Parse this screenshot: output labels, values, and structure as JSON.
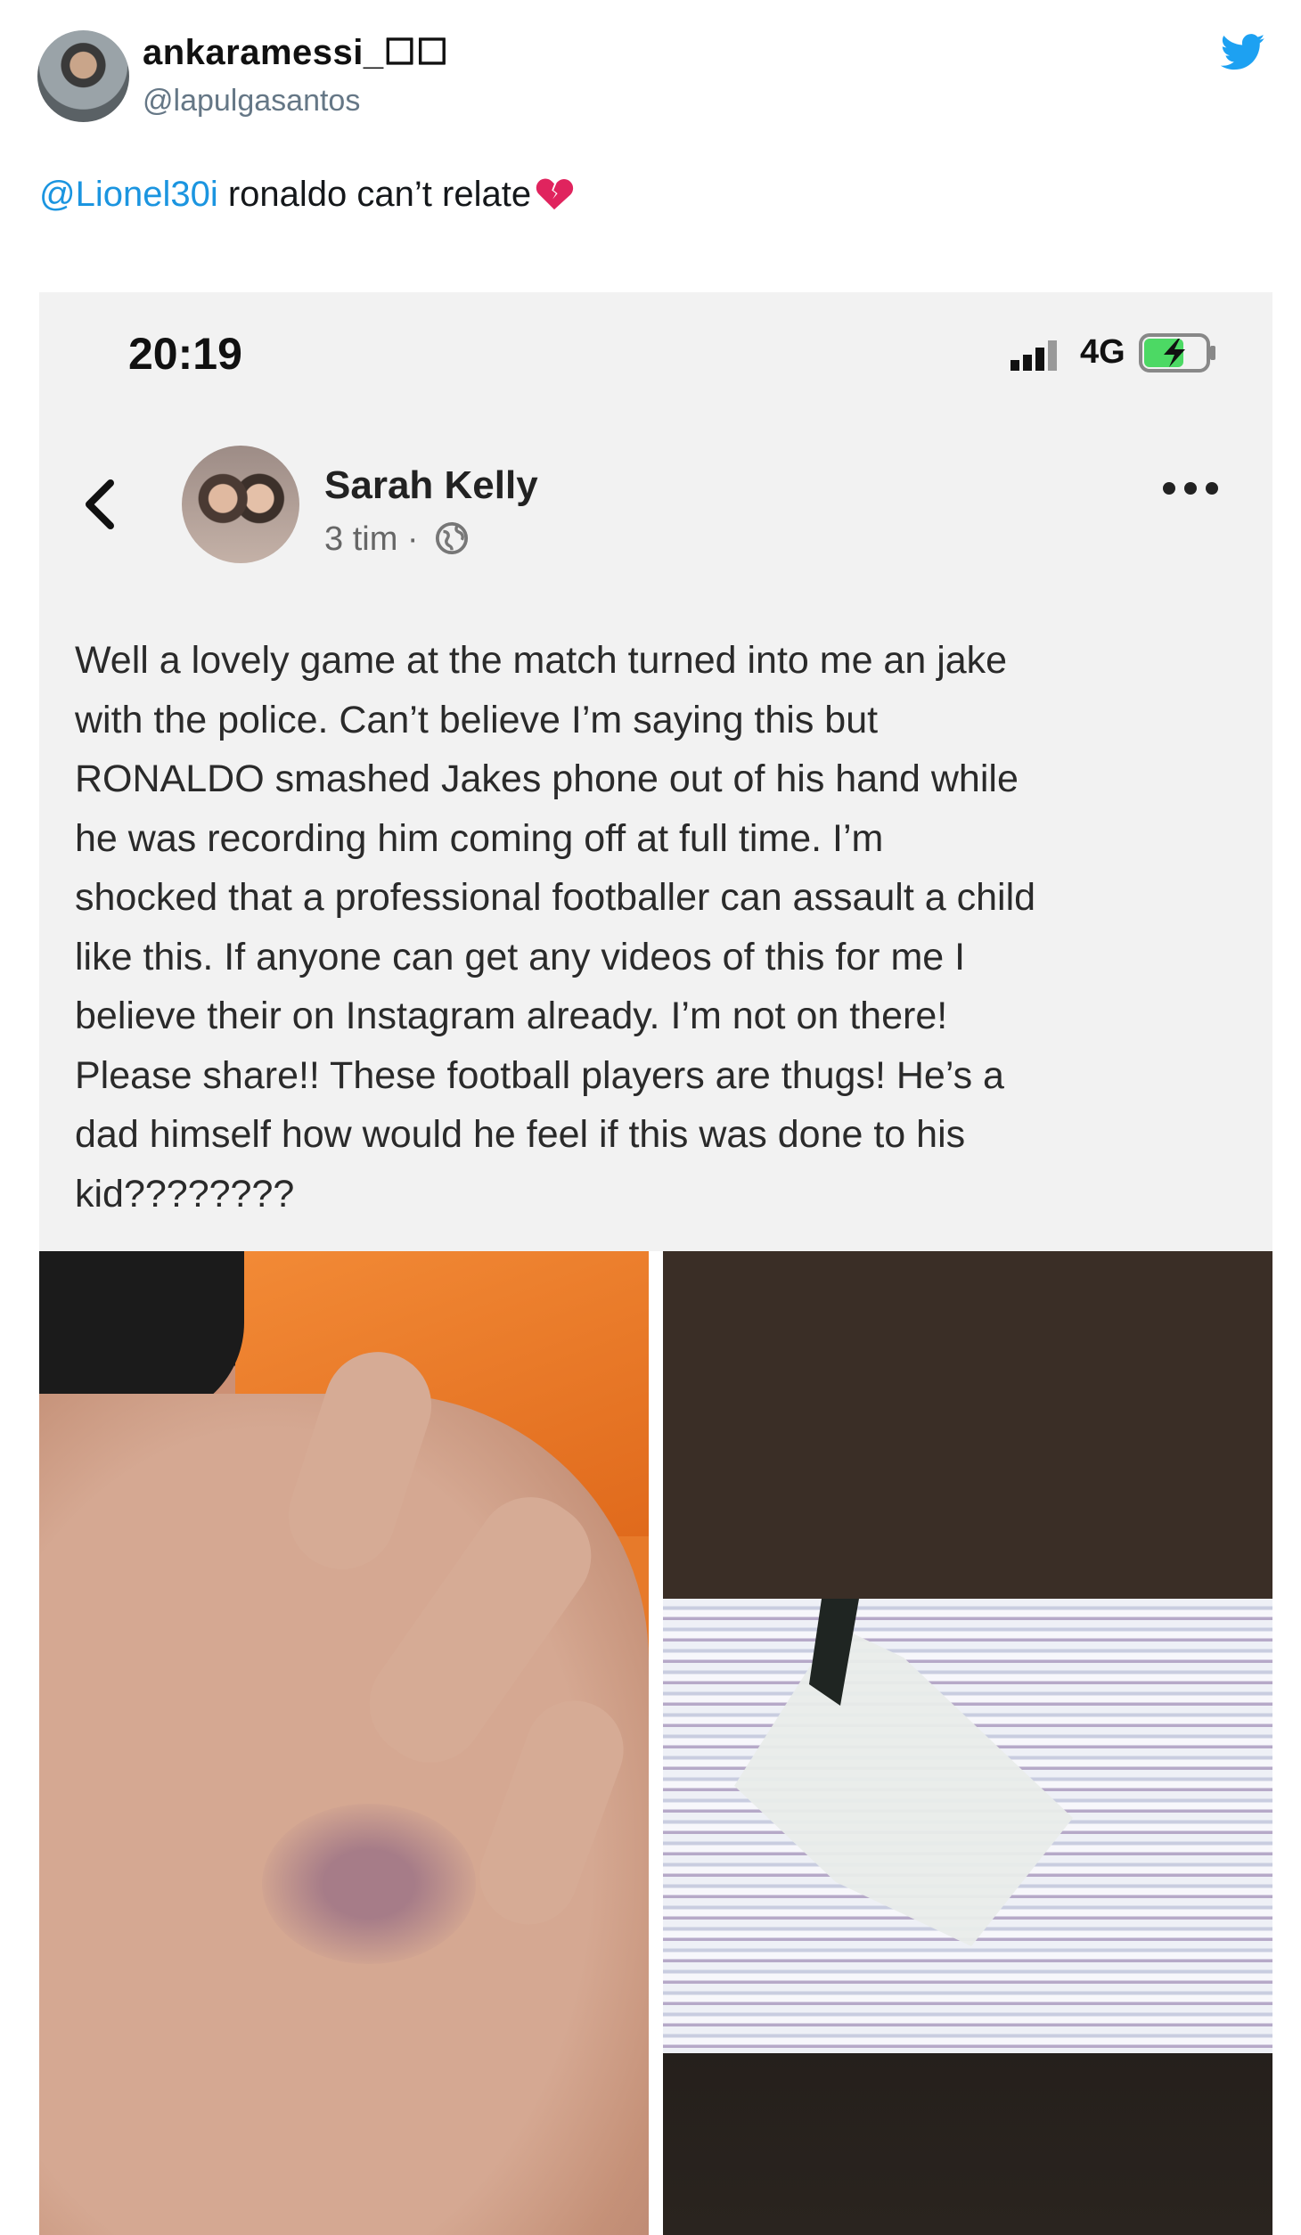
{
  "tweet": {
    "author_name": "ankaramessi_☐☐",
    "handle": "@lapulgasantos",
    "mention": "@Lionel30i",
    "text": " ronaldo can’t relate",
    "emoji": "broken-heart-icon",
    "brand_color": "#1da1f2"
  },
  "phone": {
    "time": "20:19",
    "network": "4G",
    "battery": "charging"
  },
  "facebook_post": {
    "author": "Sarah Kelly",
    "timestamp": "3 tim ·",
    "lines": [
      "Well a lovely game at the match turned into me an jake",
      "with the police. Can’t believe I’m saying this but",
      "RONALDO smashed Jakes phone out of his hand while",
      "he was recording him coming off at full time. I’m",
      "shocked that a professional footballer can assault a child",
      "like this. If anyone can get any videos of this for me I",
      "believe their on Instagram already. I’m not on there!",
      "Please share!! These football players are thugs! He’s a",
      "dad himself how would he feel if this was done to his",
      "kid????????"
    ]
  }
}
